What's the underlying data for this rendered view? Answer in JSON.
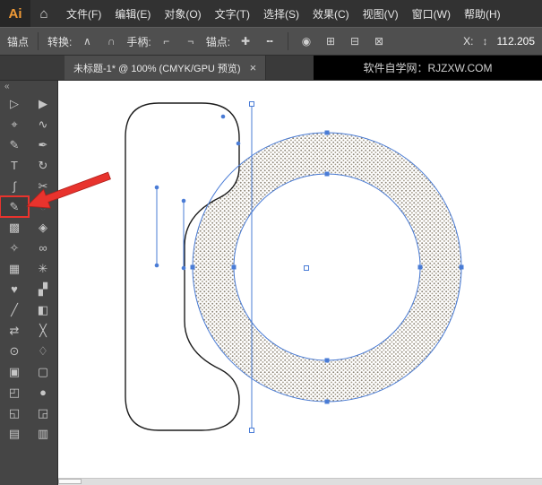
{
  "menubar": {
    "logo": "Ai",
    "home_icon": "⌂",
    "menus": [
      {
        "name": "menu-file",
        "label": "文件(F)"
      },
      {
        "name": "menu-edit",
        "label": "编辑(E)"
      },
      {
        "name": "menu-object",
        "label": "对象(O)"
      },
      {
        "name": "menu-type",
        "label": "文字(T)"
      },
      {
        "name": "menu-select",
        "label": "选择(S)"
      },
      {
        "name": "menu-effect",
        "label": "效果(C)"
      },
      {
        "name": "menu-view",
        "label": "视图(V)"
      },
      {
        "name": "menu-window",
        "label": "窗口(W)"
      },
      {
        "name": "menu-help",
        "label": "帮助(H)"
      }
    ]
  },
  "controlbar": {
    "anchor_label": "锚点",
    "convert_label": "转换:",
    "convert_corner_icon": "∧",
    "convert_smooth_icon": "∩",
    "handle_label": "手柄:",
    "handle_show_icon": "⌐",
    "handle_hide_icon": "¬",
    "anchor_edit_label": "锚点:",
    "anchor_add_icon": "✚",
    "anchor_remove_icon": "╍",
    "globe_icon": "◉",
    "grid_icon_1": "⊞",
    "grid_icon_2": "⊟",
    "grid_icon_3": "⊠",
    "x_label": "X:",
    "stepper_icon": "↕",
    "x_value": "112.205"
  },
  "tabbar": {
    "tab_title": "未标题-1* @ 100% (CMYK/GPU 预览)",
    "close_icon": "×",
    "watermark": "软件自学网：RJZXW.COM"
  },
  "toolbar": {
    "collapse_icon": "«",
    "tools": [
      {
        "name": "direct-selection-tool",
        "glyph": "▷"
      },
      {
        "name": "selection-tool",
        "glyph": "▶"
      },
      {
        "name": "magic-wand-tool",
        "glyph": "⌖"
      },
      {
        "name": "lasso-tool",
        "glyph": "∿"
      },
      {
        "name": "paintbrush-tool",
        "glyph": "✎"
      },
      {
        "name": "pen-tool",
        "glyph": "✒"
      },
      {
        "name": "type-tool",
        "glyph": "T"
      },
      {
        "name": "rotate-tool",
        "glyph": "↻"
      },
      {
        "name": "curvature-tool",
        "glyph": "∫"
      },
      {
        "name": "scissors-tool",
        "glyph": "✂"
      },
      {
        "name": "shaper-tool",
        "glyph": "✎",
        "highlighted": true
      },
      {
        "name": "shape-builder-tool",
        "glyph": "◔"
      },
      {
        "name": "gradient-tool",
        "glyph": "▩"
      },
      {
        "name": "mesh-tool",
        "glyph": "◈"
      },
      {
        "name": "eyedropper-tool",
        "glyph": "✧"
      },
      {
        "name": "blend-tool",
        "glyph": "∞"
      },
      {
        "name": "symbol-sprayer-tool",
        "glyph": "▦"
      },
      {
        "name": "graph-tool",
        "glyph": "✳"
      },
      {
        "name": "width-tool",
        "glyph": "♥"
      },
      {
        "name": "free-transform-tool",
        "glyph": "▞"
      },
      {
        "name": "knife-tool",
        "glyph": "╱"
      },
      {
        "name": "artboard-tool",
        "glyph": "◧"
      },
      {
        "name": "perspective-grid-tool",
        "glyph": "⇄"
      },
      {
        "name": "slice-tool",
        "glyph": "╳"
      },
      {
        "name": "zoom-tool",
        "glyph": "⊙"
      },
      {
        "name": "hand-tool",
        "glyph": "♢"
      },
      {
        "name": "fill-color-swatch",
        "glyph": "▣"
      },
      {
        "name": "stroke-color-swatch",
        "glyph": "▢"
      },
      {
        "name": "draw-normal-mode",
        "glyph": "◰"
      },
      {
        "name": "color-mode-button",
        "glyph": "●"
      },
      {
        "name": "draw-behind-mode",
        "glyph": "◱"
      },
      {
        "name": "draw-inside-mode",
        "glyph": "◲"
      },
      {
        "name": "screen-mode-button",
        "glyph": "▤"
      },
      {
        "name": "edit-toolbar-button",
        "glyph": "▥"
      }
    ]
  },
  "canvas": {
    "selection_color": "#4a7cd6",
    "pattern_dot_color": "#8d8577",
    "outline_color": "#1c1c1c",
    "highlight_color": "#e8332d"
  }
}
